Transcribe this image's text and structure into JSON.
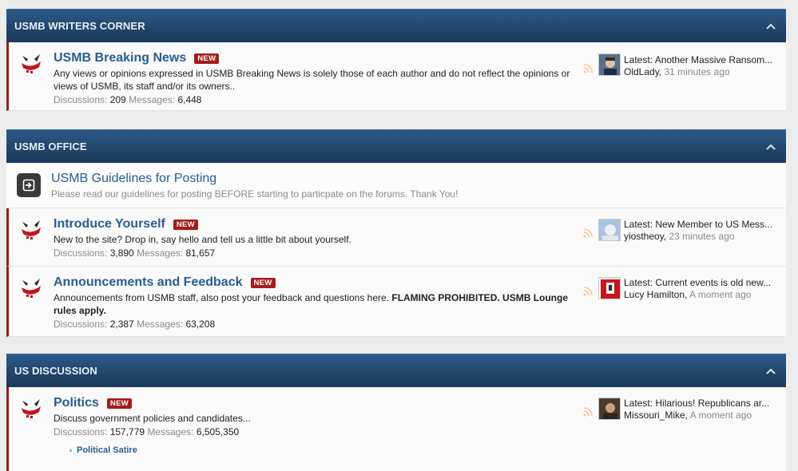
{
  "categories": [
    {
      "title": "USMB WRITERS CORNER",
      "nodes": [
        {
          "title": "USMB Breaking News",
          "badge": "NEW",
          "description": "Any views or opinions expressed in USMB Breaking News is solely those of each author and do not reflect the opinions or views of USMB, its staff and/or its owners..",
          "discussions_label": "Discussions:",
          "discussions": "209",
          "messages_label": "Messages:",
          "messages": "6,448",
          "latest": "Latest: Another Massive Ransom...",
          "latest_user": "OldLady,",
          "latest_time": "31 minutes ago"
        }
      ]
    },
    {
      "title": "USMB OFFICE",
      "link_node": {
        "title": "USMB Guidelines for Posting",
        "description": "Please read our guidelines for posting BEFORE starting to particpate on the forums. Thank You!"
      },
      "nodes": [
        {
          "title": "Introduce Yourself",
          "badge": "NEW",
          "description": "New to the site? Drop in, say hello and tell us a little bit about yourself.",
          "discussions_label": "Discussions:",
          "discussions": "3,890",
          "messages_label": "Messages:",
          "messages": "81,657",
          "latest": "Latest: New Member to US Mess...",
          "latest_user": "yiostheoy,",
          "latest_time": "23 minutes ago"
        },
        {
          "title": "Announcements and Feedback",
          "badge": "NEW",
          "description": "Announcements from USMB staff, also post your feedback and questions here.",
          "description_bold": "FLAMING PROHIBITED. USMB Lounge rules apply.",
          "discussions_label": "Discussions:",
          "discussions": "2,387",
          "messages_label": "Messages:",
          "messages": "63,208",
          "latest": "Latest: Current events is old new...",
          "latest_user": "Lucy Hamilton,",
          "latest_time": "A moment ago"
        }
      ]
    },
    {
      "title": "US DISCUSSION",
      "nodes": [
        {
          "title": "Politics",
          "badge": "NEW",
          "description": "Discuss government policies and candidates...",
          "discussions_label": "Discussions:",
          "discussions": "157,779",
          "messages_label": "Messages:",
          "messages": "6,505,350",
          "subforum": "Political Satire",
          "latest": "Latest: Hilarious! Republicans ar...",
          "latest_user": "Missouri_Mike,",
          "latest_time": "A moment ago"
        }
      ]
    }
  ],
  "colors": {
    "header": "#22456b",
    "title_link": "#2a5c92",
    "badge": "#a51b1b",
    "unread_bar": "#9b1c1c"
  },
  "icons": {
    "forum": "usmb-logo-icon",
    "link": "arrow-right-box-icon",
    "collapse": "chevron-up-icon",
    "rss": "rss-icon"
  }
}
